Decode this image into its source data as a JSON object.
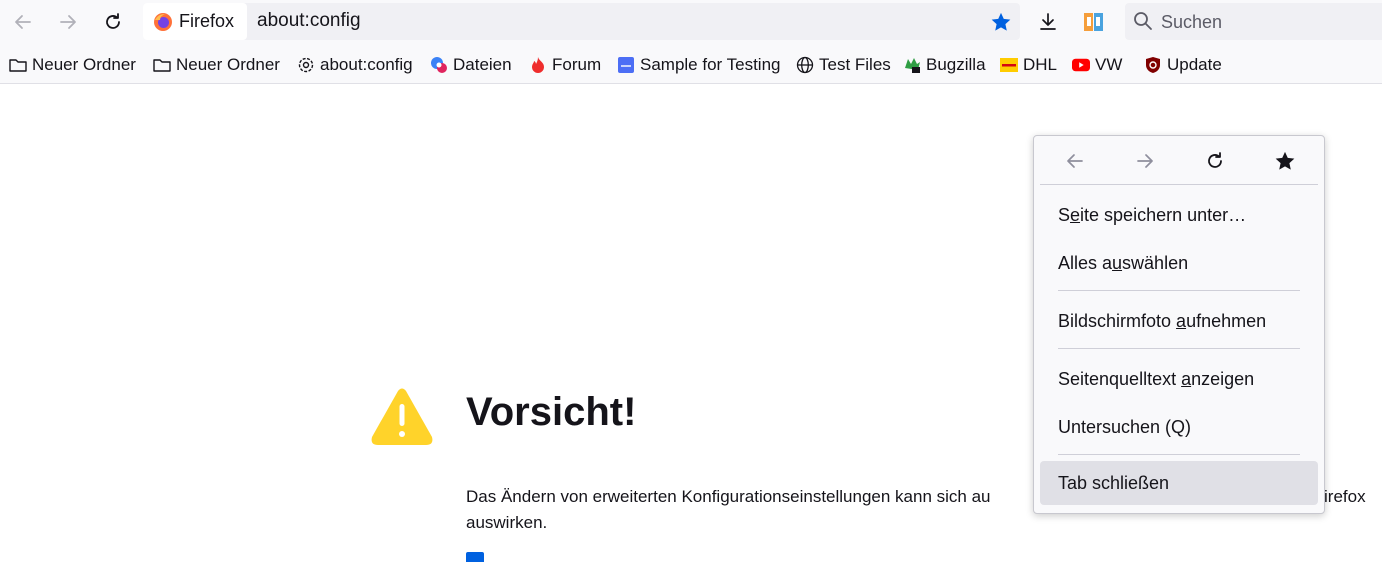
{
  "toolbar": {
    "identity_label": "Firefox",
    "url": "about:config",
    "search_placeholder": "Suchen"
  },
  "bookmarks": [
    {
      "label": "Neuer Ordner",
      "icon": "folder-icon"
    },
    {
      "label": "Neuer Ordner",
      "icon": "folder-icon"
    },
    {
      "label": "about:config",
      "icon": "gear-icon"
    },
    {
      "label": "Dateien",
      "icon": "dateien-icon"
    },
    {
      "label": "Forum",
      "icon": "flame-icon"
    },
    {
      "label": "Sample for Testing",
      "icon": "sample-icon"
    },
    {
      "label": "Test Files",
      "icon": "globe-icon"
    },
    {
      "label": "Bugzilla",
      "icon": "bugzilla-icon"
    },
    {
      "label": "DHL",
      "icon": "dhl-icon"
    },
    {
      "label": "VW",
      "icon": "youtube-icon"
    },
    {
      "label": "Update",
      "icon": "ublock-icon"
    }
  ],
  "page": {
    "heading": "Vorsicht!",
    "description": "Das Ändern von erweiterten Konfigurationseinstellungen kann sich au",
    "description_tail": "irefox",
    "description_line2": "auswirken."
  },
  "context_menu": {
    "items": [
      {
        "pre": "S",
        "accel": "e",
        "post": "ite speichern unter…"
      },
      {
        "pre": "Alles a",
        "accel": "u",
        "post": "swählen"
      },
      {
        "pre": "Bildschirmfoto ",
        "accel": "a",
        "post": "ufnehmen"
      },
      {
        "pre": "Seitenquelltext ",
        "accel": "a",
        "post": "nzeigen"
      },
      {
        "pre": "Untersuchen (Q)",
        "accel": "",
        "post": ""
      },
      {
        "pre": "Tab schließen",
        "accel": "",
        "post": ""
      }
    ]
  },
  "colors": {
    "accent": "#0061e0",
    "warning": "#ffd32a",
    "menu_hover": "#e0e0e6"
  }
}
